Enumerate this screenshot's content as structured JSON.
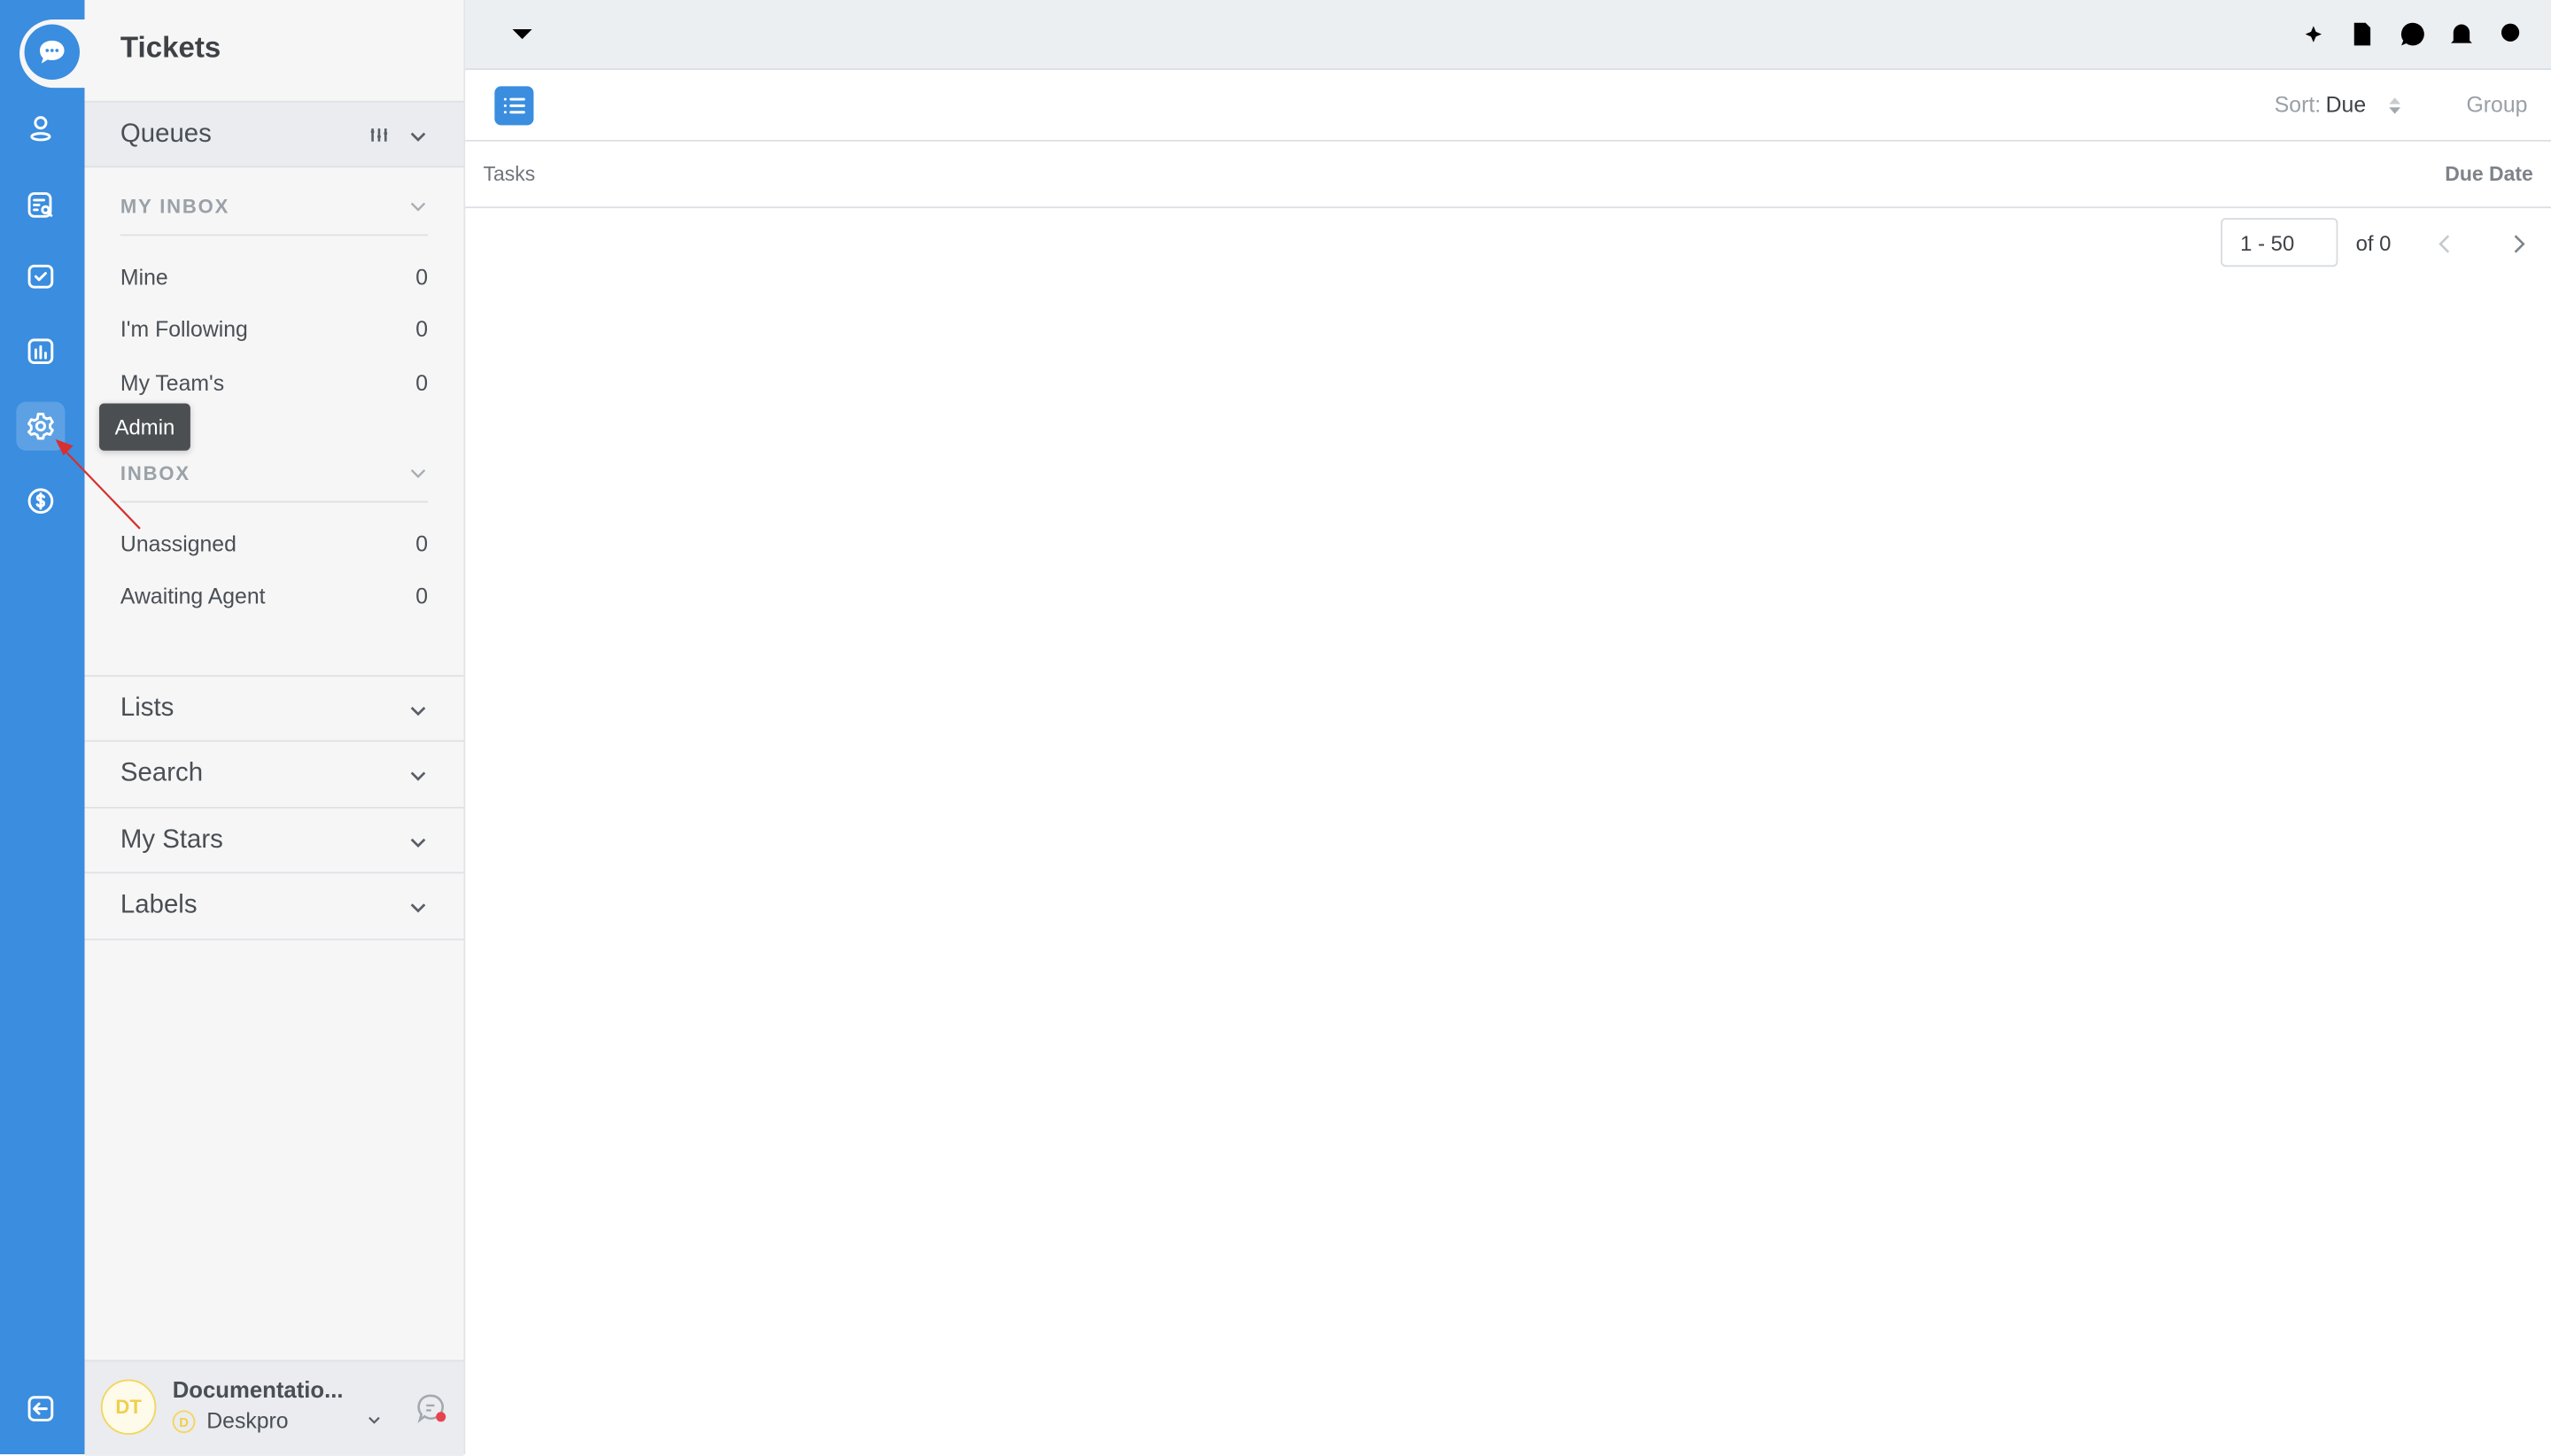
{
  "app": {
    "title": "Tickets",
    "accent": "#3a8ddf"
  },
  "rail": {
    "items": [
      {
        "icon": "chat-icon",
        "label": "Tickets"
      },
      {
        "icon": "user-icon"
      },
      {
        "icon": "search-document-icon"
      },
      {
        "icon": "task-check-icon"
      },
      {
        "icon": "chart-icon"
      },
      {
        "icon": "gear-icon",
        "label": "Admin"
      },
      {
        "icon": "dollar-icon"
      },
      {
        "icon": "collapse-icon"
      }
    ],
    "tooltip": "Admin"
  },
  "sidebar": {
    "queues": "Queues",
    "my_inbox": {
      "label": "MY INBOX",
      "items": [
        {
          "label": "Mine",
          "count": "0"
        },
        {
          "label": "I'm Following",
          "count": "0"
        },
        {
          "label": "My Team's",
          "count": "0"
        }
      ]
    },
    "inbox": {
      "label": "INBOX",
      "items": [
        {
          "label": "Unassigned",
          "count": "0"
        },
        {
          "label": "Awaiting Agent",
          "count": "0"
        }
      ]
    },
    "sections": [
      "Lists",
      "Search",
      "My Stars",
      "Labels"
    ],
    "footer": {
      "avatar": "DT",
      "name": "Documentatio...",
      "brand_initial": "D",
      "brand": "Deskpro",
      "avatar_color": "#f2d65c"
    }
  },
  "main": {
    "sort_label": "Sort:",
    "sort_value": "Due",
    "group_label": "Group",
    "columns": [
      "Tasks",
      "Due Date"
    ],
    "pagination": {
      "range": "1 - 50",
      "of": "of 0"
    }
  }
}
